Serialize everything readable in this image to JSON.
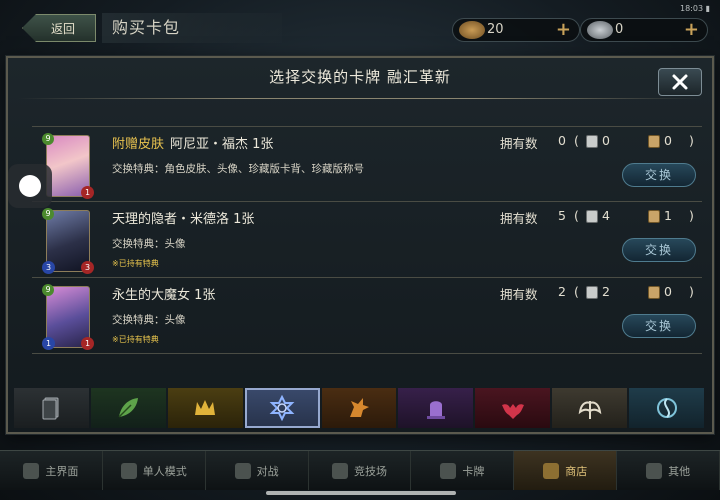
{
  "topbar": {
    "back_label": "返回",
    "screen_title": "购买卡包",
    "currency_gold": "20",
    "currency_silver": "0",
    "status_text": "18:03 ▮"
  },
  "dialog": {
    "title": "选择交换的卡牌 融汇革新",
    "close_label": "✕"
  },
  "rows": [
    {
      "skin_prefix": "附赠皮肤",
      "name": "阿尼亚・福杰 1张",
      "benefit": "交换特典：角色皮肤、头像、珍藏版卡背、珍藏版称号",
      "note": "",
      "owned_label": "拥有数",
      "owned": "0",
      "paren_l": "(",
      "a_count": "0",
      "b_count": "0",
      "paren_r": ")",
      "button": "交换",
      "cost": "9",
      "atk": "1",
      "hp": "1"
    },
    {
      "skin_prefix": "",
      "name": "天理的隐者・米德洛 1张",
      "benefit": "交换特典：头像",
      "note": "※已持有特典",
      "owned_label": "拥有数",
      "owned": "5",
      "paren_l": "(",
      "a_count": "4",
      "b_count": "1",
      "paren_r": ")",
      "button": "交换",
      "cost": "9",
      "atk": "3",
      "hp": "3"
    },
    {
      "skin_prefix": "",
      "name": "永生的大魔女 1张",
      "benefit": "交换特典：头像",
      "note": "※已持有特典",
      "owned_label": "拥有数",
      "owned": "2",
      "paren_l": "(",
      "a_count": "2",
      "b_count": "0",
      "paren_r": ")",
      "button": "交换",
      "cost": "9",
      "atk": "1",
      "hp": "1"
    }
  ],
  "class_tabs": [
    {
      "icon": "neutral-card-icon"
    },
    {
      "icon": "forestcraft-leaf-icon"
    },
    {
      "icon": "swordcraft-crown-icon"
    },
    {
      "icon": "runecraft-rune-icon",
      "selected": true
    },
    {
      "icon": "dragoncraft-dragon-icon"
    },
    {
      "icon": "shadowcraft-tomb-icon"
    },
    {
      "icon": "bloodcraft-bat-icon"
    },
    {
      "icon": "havencraft-wings-icon"
    },
    {
      "icon": "portalcraft-portal-icon"
    }
  ],
  "nav": {
    "home": "主界面",
    "solo": "单人模式",
    "battle": "对战",
    "arena": "竞技场",
    "cards": "卡牌",
    "shop": "商店",
    "other": "其他"
  },
  "colors": {
    "accent_gold": "#e8c24f",
    "button_blue": "#27485a",
    "selected_tab": "#97a9cf"
  }
}
